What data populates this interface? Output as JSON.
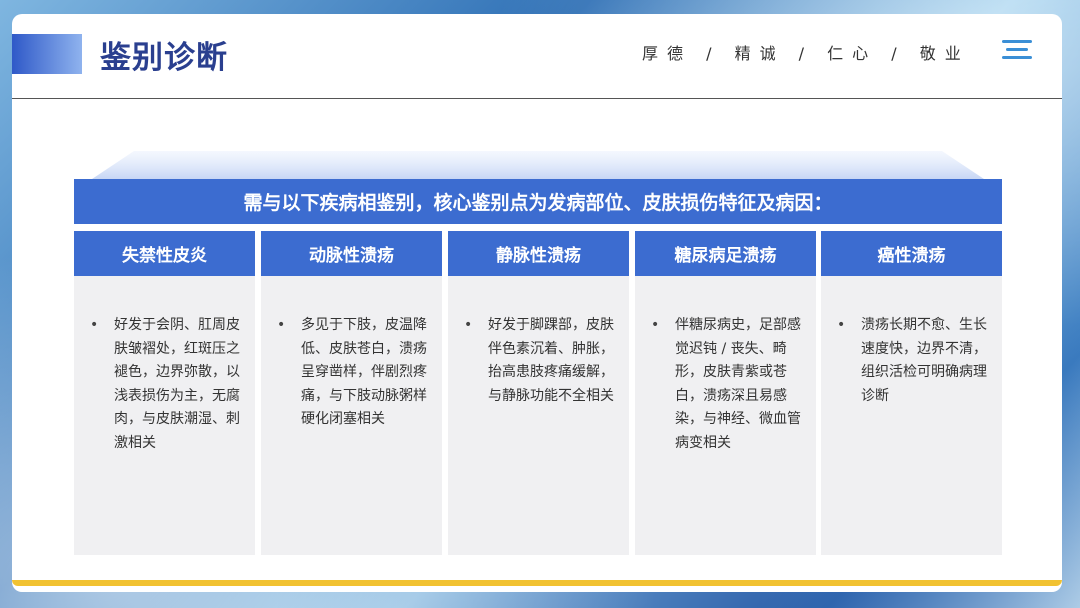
{
  "header": {
    "title": "鉴别诊断",
    "motto": "厚德 / 精诚 / 仁心 / 敬业",
    "menu_icon": "menu-icon"
  },
  "banner": {
    "text": "需与以下疾病相鉴别，核心鉴别点为发病部位、皮肤损伤特征及病因："
  },
  "columns": [
    {
      "title": "失禁性皮炎",
      "bullet": "•",
      "text": "好发于会阴、肛周皮肤皱褶处，红斑压之褪色，边界弥散，以浅表损伤为主，无腐肉，与皮肤潮湿、刺激相关"
    },
    {
      "title": "动脉性溃疡",
      "bullet": "•",
      "text": "多见于下肢，皮温降低、皮肤苍白，溃疡呈穿凿样，伴剧烈疼痛，与下肢动脉粥样硬化闭塞相关"
    },
    {
      "title": "静脉性溃疡",
      "bullet": "•",
      "text": "好发于脚踝部，皮肤伴色素沉着、肿胀，抬高患肢疼痛缓解，与静脉功能不全相关"
    },
    {
      "title": "糖尿病足溃疡",
      "bullet": "•",
      "text": "伴糖尿病史，足部感觉迟钝 / 丧失、畸形，皮肤青紫或苍白，溃疡深且易感染，与神经、微血管病变相关"
    },
    {
      "title": "癌性溃疡",
      "bullet": "•",
      "text": "溃疡长期不愈、生长速度快，边界不清，组织活检可明确病理诊断"
    }
  ],
  "colors": {
    "primary_blue": "#3c6cd0",
    "title_blue": "#2a3f8f",
    "accent_gold": "#f1c232",
    "panel_gray": "#f0f0f2"
  }
}
